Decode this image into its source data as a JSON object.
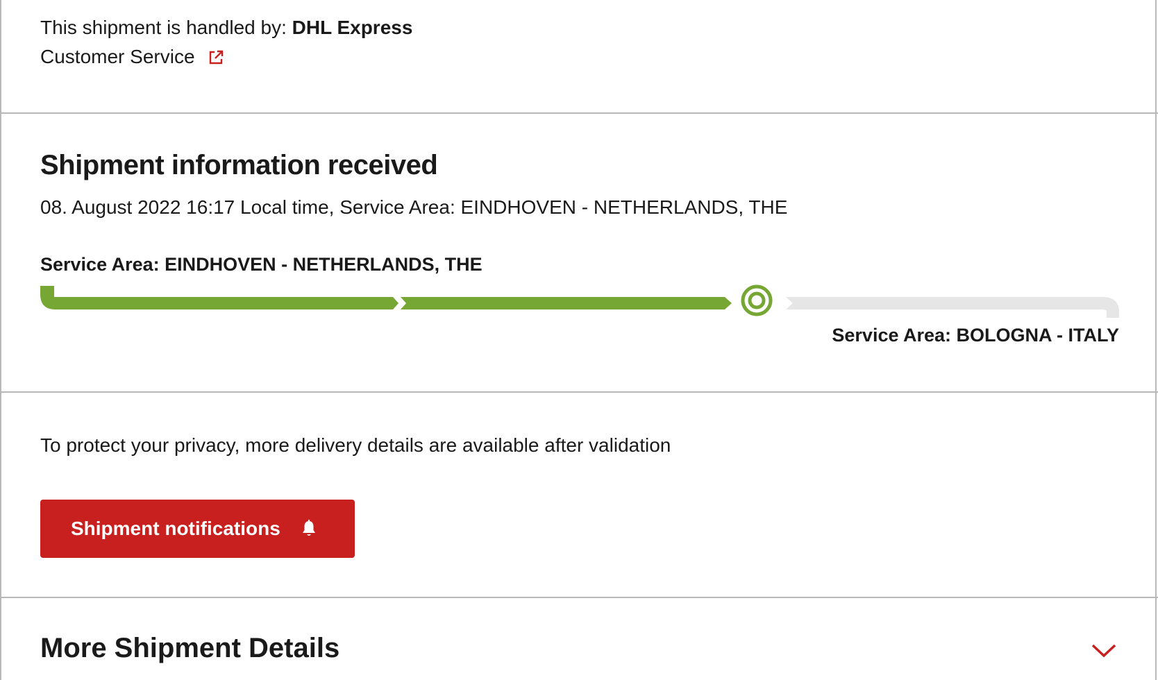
{
  "handler": {
    "prefix": "This shipment is handled by: ",
    "carrier": "DHL Express"
  },
  "customer_service": {
    "label": "Customer Service",
    "icon": "external-link-icon"
  },
  "event": {
    "title": "Shipment information received",
    "datetime": "08. August 2022 16:17 Local time, Service Area: EINDHOVEN - NETHERLANDS, THE"
  },
  "route": {
    "origin": "Service Area: EINDHOVEN - NETHERLANDS, THE",
    "destination": "Service Area: BOLOGNA - ITALY",
    "progress_fraction": 0.66,
    "colors": {
      "complete": "#76a634",
      "pending": "#e6e6e6"
    }
  },
  "privacy_note": "To protect your privacy, more delivery details are available after validation",
  "notifications_button": {
    "label": "Shipment notifications",
    "icon": "bell-icon",
    "color": "#c8201f"
  },
  "more_details": {
    "label": "More Shipment Details",
    "icon": "chevron-down-icon"
  },
  "colors": {
    "accent": "#c8201f",
    "text": "#1a1a1a",
    "divider": "#b8b8b8"
  }
}
